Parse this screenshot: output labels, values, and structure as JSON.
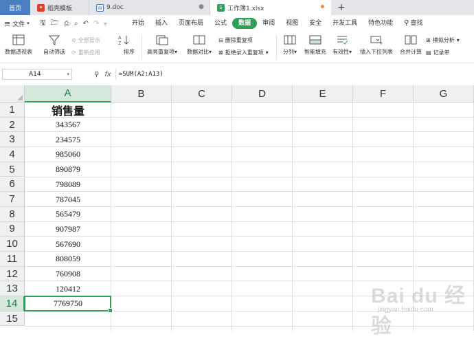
{
  "tabs": [
    {
      "label": "首页"
    },
    {
      "label": "稻壳模板",
      "icon": "docer-icon"
    },
    {
      "label": "9.doc",
      "icon": "word-doc-icon"
    },
    {
      "label": "工作簿1.xlsx",
      "icon": "sheet-icon"
    }
  ],
  "new_tab": "+",
  "menu": {
    "file": "文件",
    "items": [
      "开始",
      "插入",
      "页面布局",
      "公式",
      "数据",
      "审阅",
      "视图",
      "安全",
      "开发工具",
      "特色功能"
    ],
    "active": "数据",
    "search": "查找"
  },
  "ribbon": {
    "pivot": "数据透视表",
    "autofilter": "自动筛选",
    "show_all": "全部显示",
    "reapply": "重新应用",
    "sort": "排序",
    "highlight_dup": "高亮重复项",
    "compare": "数据对比",
    "remove_dup": "删除重复项",
    "reject_dup": "拒绝录入重复项",
    "split": "分列",
    "smart_fill": "智能填充",
    "validity": "有效性",
    "dropdown": "插入下拉列表",
    "consolidate": "合并计算",
    "whatif": "模拟分析",
    "record": "记录单"
  },
  "formula_bar": {
    "name_box": "A14",
    "fx": "fx",
    "formula": "=SUM(A2:A13)"
  },
  "columns": [
    "A",
    "B",
    "C",
    "D",
    "E",
    "F",
    "G"
  ],
  "selected_column": "A",
  "rows": [
    "1",
    "2",
    "3",
    "4",
    "5",
    "6",
    "7",
    "8",
    "9",
    "10",
    "11",
    "12",
    "13",
    "14",
    "15"
  ],
  "selected_row": "14",
  "column_a": [
    "销售量",
    "343567",
    "234575",
    "985060",
    "890879",
    "798089",
    "787045",
    "565479",
    "907987",
    "567690",
    "808059",
    "760908",
    "120412",
    "7769750",
    ""
  ],
  "watermark": {
    "brand": "Bai du 经验",
    "url": "jingyan.baidu.com"
  },
  "colors": {
    "accent": "#2e9e58",
    "home_tab": "#4a7fc1",
    "active_tab_icon": "#2e9e58"
  }
}
